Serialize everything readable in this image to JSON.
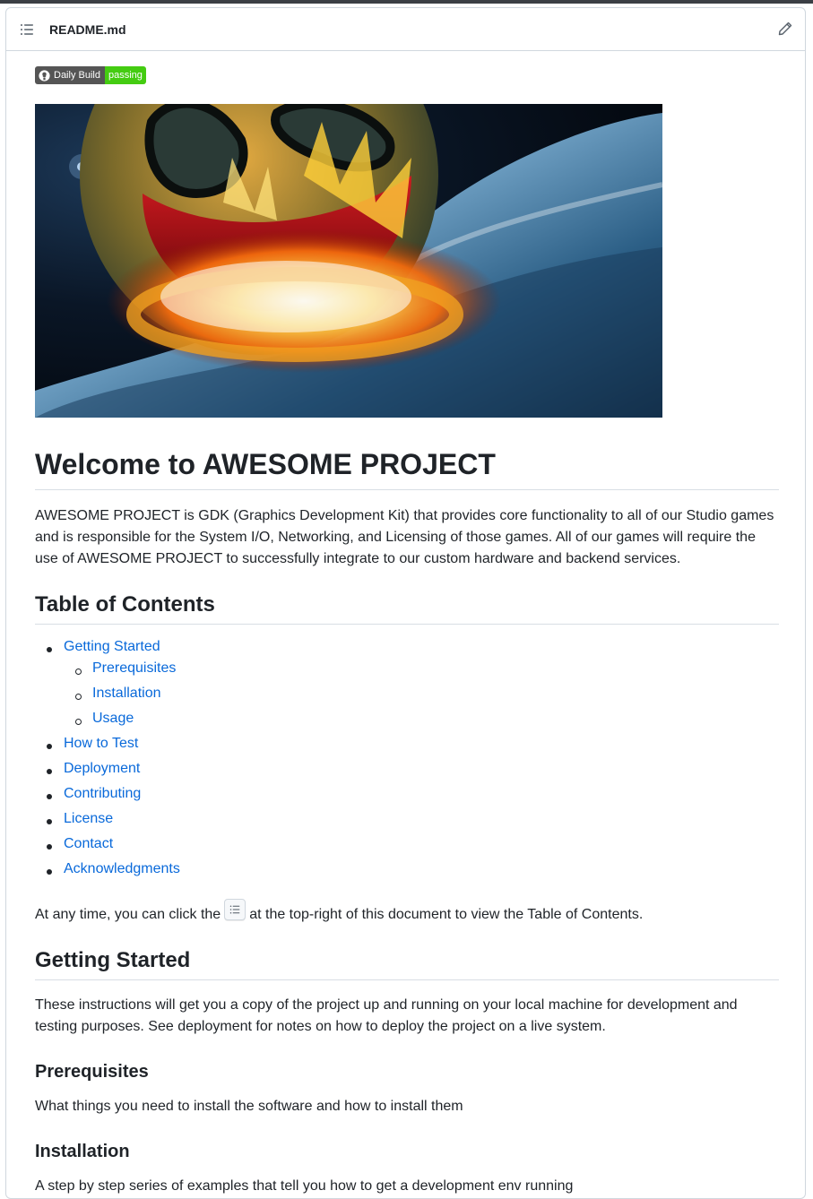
{
  "header": {
    "file_name": "README.md",
    "toc_icon": "list-unordered-icon",
    "edit_icon": "pencil-icon"
  },
  "badge": {
    "label": "Daily Build",
    "status": "passing",
    "icon": "github-icon",
    "colors": {
      "label_bg": "#555555",
      "status_bg": "#44cc11"
    }
  },
  "hero_image": {
    "alt": "awesome smiley crashing into planet",
    "icon": "hero-image"
  },
  "doc": {
    "title": "Welcome to AWESOME PROJECT",
    "intro": "AWESOME PROJECT is GDK (Graphics Development Kit) that provides core functionality to all of our Studio games and is responsible for the System I/O, Networking, and Licensing of those games. All of our games will require the use of AWESOME PROJECT to successfully integrate to our custom hardware and backend services.",
    "toc_heading": "Table of Contents",
    "toc": [
      {
        "label": "Getting Started"
      },
      {
        "label": "Prerequisites"
      },
      {
        "label": "Installation"
      },
      {
        "label": "Usage"
      },
      {
        "label": "How to Test"
      },
      {
        "label": "Deployment"
      },
      {
        "label": "Contributing"
      },
      {
        "label": "License"
      },
      {
        "label": "Contact"
      },
      {
        "label": "Acknowledgments"
      }
    ],
    "click_hint_before": "At any time, you can click the",
    "click_hint_after": "at the top-right of this document to view the Table of Contents.",
    "getting_started_heading": "Getting Started",
    "getting_started_text": "These instructions will get you a copy of the project up and running on your local machine for development and testing purposes. See deployment for notes on how to deploy the project on a live system.",
    "prerequisites_heading": "Prerequisites",
    "prerequisites_text": "What things you need to install the software and how to install them",
    "installation_heading": "Installation",
    "installation_text": "A step by step series of examples that tell you how to get a development env running"
  },
  "colors": {
    "link": "#0969da",
    "text": "#1f2328",
    "border": "#d0d7de"
  }
}
